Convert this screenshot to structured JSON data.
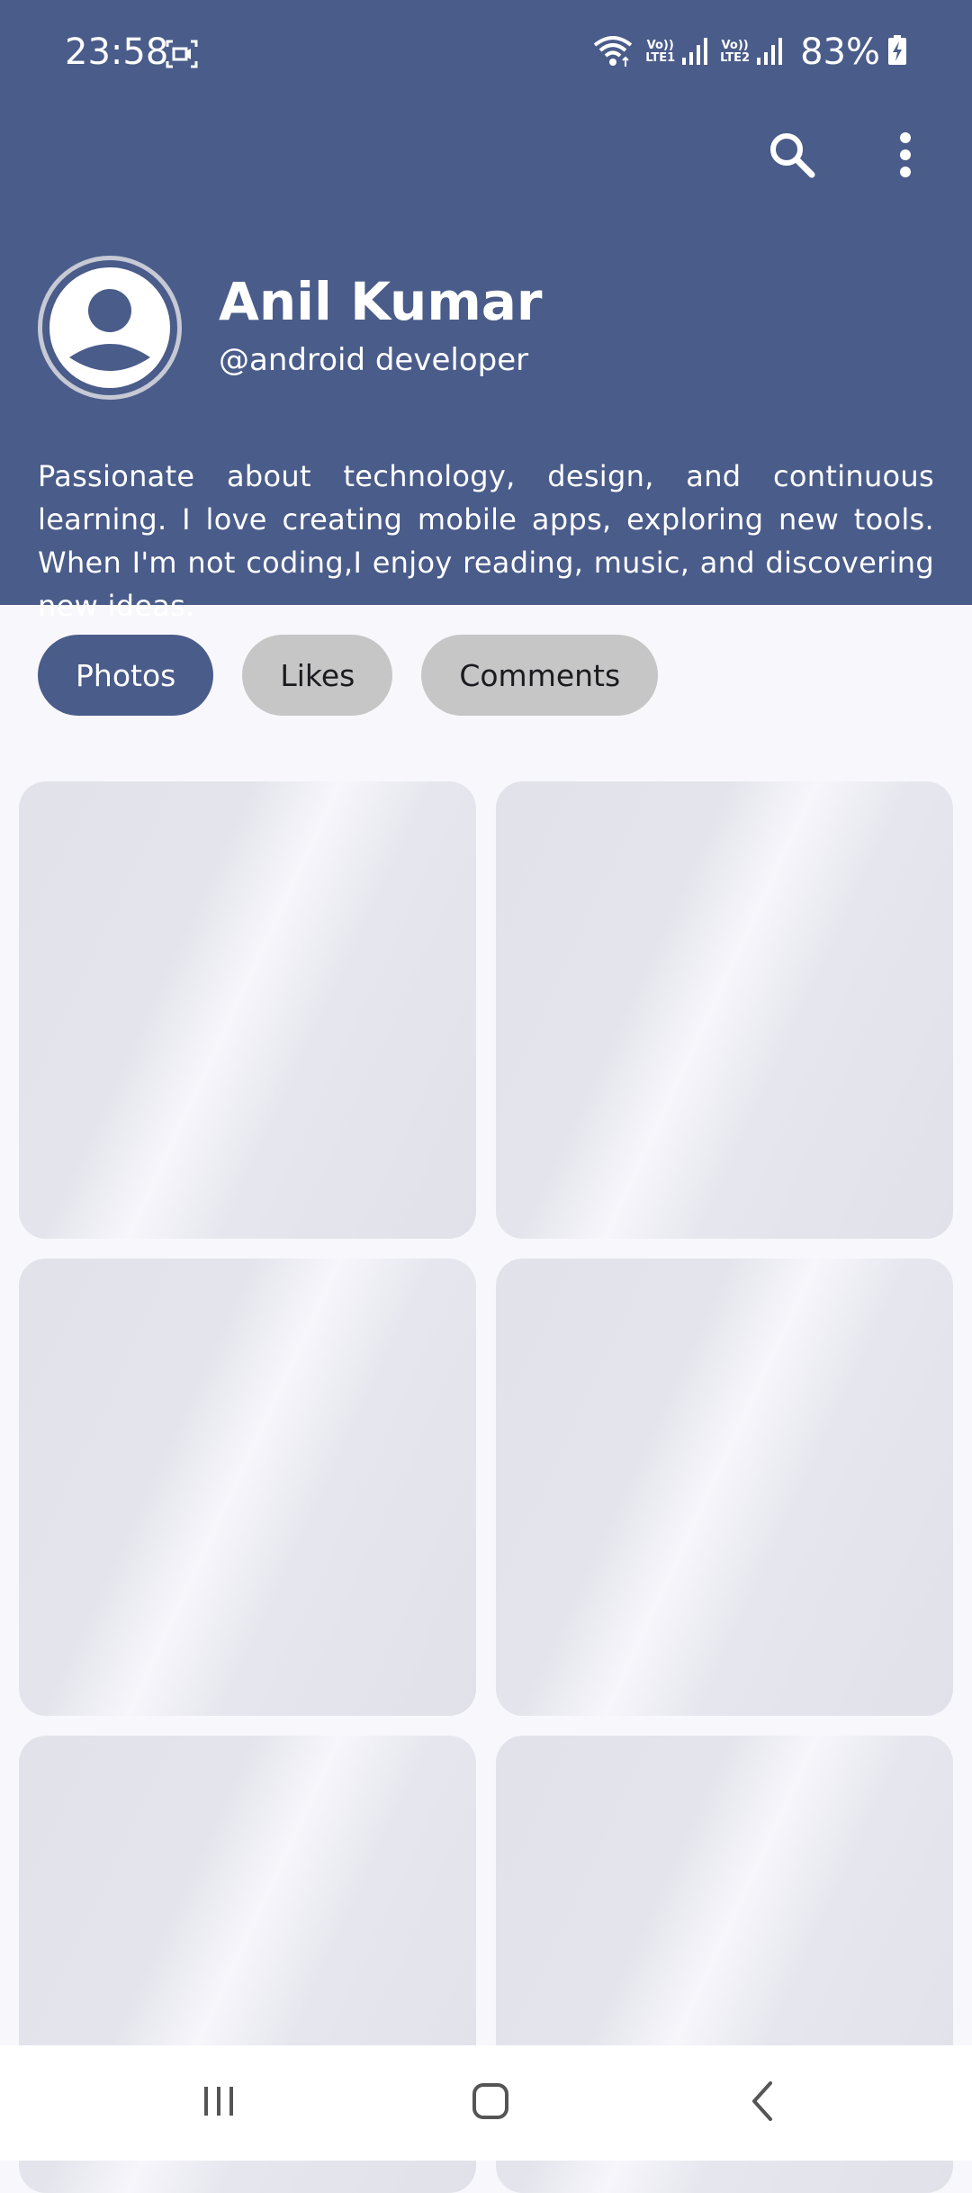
{
  "status_bar": {
    "time": "23:58",
    "battery_percent": "83%",
    "sim1_top": "Vo))",
    "sim1_bottom": "LTE1",
    "sim2_top": "Vo))",
    "sim2_bottom": "LTE2",
    "icons": [
      "screen-record-icon",
      "wifi-icon",
      "signal-icon",
      "signal-icon",
      "battery-charging-icon"
    ]
  },
  "app_bar": {
    "actions": [
      "search-icon",
      "more-vert-icon"
    ]
  },
  "profile": {
    "name": "Anil Kumar",
    "handle": "@android developer",
    "bio": "Passionate about technology, design, and continuous learning. I love creating mobile apps, exploring new tools. When I'm not coding,I enjoy reading, music, and discovering new ideas.",
    "avatar_icon": "account-circle-icon"
  },
  "tabs": [
    {
      "label": "Photos",
      "active": true
    },
    {
      "label": "Likes",
      "active": false
    },
    {
      "label": "Comments",
      "active": false
    }
  ],
  "grid": {
    "tile_count": 6
  },
  "nav_bar": {
    "buttons": [
      "recents-icon",
      "home-icon",
      "back-icon"
    ]
  },
  "colors": {
    "primary": "#4a5c8a",
    "chip_inactive": "#c6c6c6",
    "background": "#f8f7fc"
  }
}
